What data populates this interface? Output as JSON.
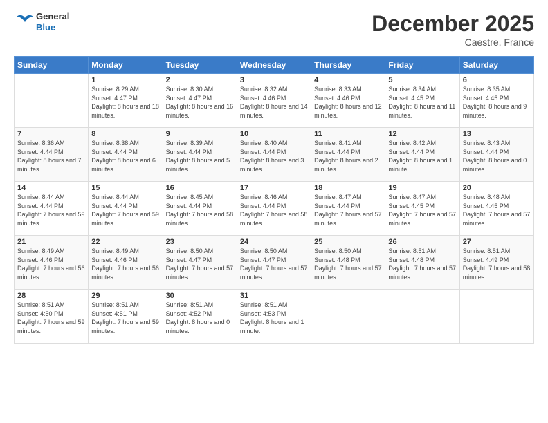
{
  "header": {
    "logo_general": "General",
    "logo_blue": "Blue",
    "month_title": "December 2025",
    "location": "Caestre, France"
  },
  "days_of_week": [
    "Sunday",
    "Monday",
    "Tuesday",
    "Wednesday",
    "Thursday",
    "Friday",
    "Saturday"
  ],
  "weeks": [
    [
      {
        "day": "",
        "sunrise": "",
        "sunset": "",
        "daylight": ""
      },
      {
        "day": "1",
        "sunrise": "Sunrise: 8:29 AM",
        "sunset": "Sunset: 4:47 PM",
        "daylight": "Daylight: 8 hours and 18 minutes."
      },
      {
        "day": "2",
        "sunrise": "Sunrise: 8:30 AM",
        "sunset": "Sunset: 4:47 PM",
        "daylight": "Daylight: 8 hours and 16 minutes."
      },
      {
        "day": "3",
        "sunrise": "Sunrise: 8:32 AM",
        "sunset": "Sunset: 4:46 PM",
        "daylight": "Daylight: 8 hours and 14 minutes."
      },
      {
        "day": "4",
        "sunrise": "Sunrise: 8:33 AM",
        "sunset": "Sunset: 4:46 PM",
        "daylight": "Daylight: 8 hours and 12 minutes."
      },
      {
        "day": "5",
        "sunrise": "Sunrise: 8:34 AM",
        "sunset": "Sunset: 4:45 PM",
        "daylight": "Daylight: 8 hours and 11 minutes."
      },
      {
        "day": "6",
        "sunrise": "Sunrise: 8:35 AM",
        "sunset": "Sunset: 4:45 PM",
        "daylight": "Daylight: 8 hours and 9 minutes."
      }
    ],
    [
      {
        "day": "7",
        "sunrise": "Sunrise: 8:36 AM",
        "sunset": "Sunset: 4:44 PM",
        "daylight": "Daylight: 8 hours and 7 minutes."
      },
      {
        "day": "8",
        "sunrise": "Sunrise: 8:38 AM",
        "sunset": "Sunset: 4:44 PM",
        "daylight": "Daylight: 8 hours and 6 minutes."
      },
      {
        "day": "9",
        "sunrise": "Sunrise: 8:39 AM",
        "sunset": "Sunset: 4:44 PM",
        "daylight": "Daylight: 8 hours and 5 minutes."
      },
      {
        "day": "10",
        "sunrise": "Sunrise: 8:40 AM",
        "sunset": "Sunset: 4:44 PM",
        "daylight": "Daylight: 8 hours and 3 minutes."
      },
      {
        "day": "11",
        "sunrise": "Sunrise: 8:41 AM",
        "sunset": "Sunset: 4:44 PM",
        "daylight": "Daylight: 8 hours and 2 minutes."
      },
      {
        "day": "12",
        "sunrise": "Sunrise: 8:42 AM",
        "sunset": "Sunset: 4:44 PM",
        "daylight": "Daylight: 8 hours and 1 minute."
      },
      {
        "day": "13",
        "sunrise": "Sunrise: 8:43 AM",
        "sunset": "Sunset: 4:44 PM",
        "daylight": "Daylight: 8 hours and 0 minutes."
      }
    ],
    [
      {
        "day": "14",
        "sunrise": "Sunrise: 8:44 AM",
        "sunset": "Sunset: 4:44 PM",
        "daylight": "Daylight: 7 hours and 59 minutes."
      },
      {
        "day": "15",
        "sunrise": "Sunrise: 8:44 AM",
        "sunset": "Sunset: 4:44 PM",
        "daylight": "Daylight: 7 hours and 59 minutes."
      },
      {
        "day": "16",
        "sunrise": "Sunrise: 8:45 AM",
        "sunset": "Sunset: 4:44 PM",
        "daylight": "Daylight: 7 hours and 58 minutes."
      },
      {
        "day": "17",
        "sunrise": "Sunrise: 8:46 AM",
        "sunset": "Sunset: 4:44 PM",
        "daylight": "Daylight: 7 hours and 58 minutes."
      },
      {
        "day": "18",
        "sunrise": "Sunrise: 8:47 AM",
        "sunset": "Sunset: 4:44 PM",
        "daylight": "Daylight: 7 hours and 57 minutes."
      },
      {
        "day": "19",
        "sunrise": "Sunrise: 8:47 AM",
        "sunset": "Sunset: 4:45 PM",
        "daylight": "Daylight: 7 hours and 57 minutes."
      },
      {
        "day": "20",
        "sunrise": "Sunrise: 8:48 AM",
        "sunset": "Sunset: 4:45 PM",
        "daylight": "Daylight: 7 hours and 57 minutes."
      }
    ],
    [
      {
        "day": "21",
        "sunrise": "Sunrise: 8:49 AM",
        "sunset": "Sunset: 4:46 PM",
        "daylight": "Daylight: 7 hours and 56 minutes."
      },
      {
        "day": "22",
        "sunrise": "Sunrise: 8:49 AM",
        "sunset": "Sunset: 4:46 PM",
        "daylight": "Daylight: 7 hours and 56 minutes."
      },
      {
        "day": "23",
        "sunrise": "Sunrise: 8:50 AM",
        "sunset": "Sunset: 4:47 PM",
        "daylight": "Daylight: 7 hours and 57 minutes."
      },
      {
        "day": "24",
        "sunrise": "Sunrise: 8:50 AM",
        "sunset": "Sunset: 4:47 PM",
        "daylight": "Daylight: 7 hours and 57 minutes."
      },
      {
        "day": "25",
        "sunrise": "Sunrise: 8:50 AM",
        "sunset": "Sunset: 4:48 PM",
        "daylight": "Daylight: 7 hours and 57 minutes."
      },
      {
        "day": "26",
        "sunrise": "Sunrise: 8:51 AM",
        "sunset": "Sunset: 4:48 PM",
        "daylight": "Daylight: 7 hours and 57 minutes."
      },
      {
        "day": "27",
        "sunrise": "Sunrise: 8:51 AM",
        "sunset": "Sunset: 4:49 PM",
        "daylight": "Daylight: 7 hours and 58 minutes."
      }
    ],
    [
      {
        "day": "28",
        "sunrise": "Sunrise: 8:51 AM",
        "sunset": "Sunset: 4:50 PM",
        "daylight": "Daylight: 7 hours and 59 minutes."
      },
      {
        "day": "29",
        "sunrise": "Sunrise: 8:51 AM",
        "sunset": "Sunset: 4:51 PM",
        "daylight": "Daylight: 7 hours and 59 minutes."
      },
      {
        "day": "30",
        "sunrise": "Sunrise: 8:51 AM",
        "sunset": "Sunset: 4:52 PM",
        "daylight": "Daylight: 8 hours and 0 minutes."
      },
      {
        "day": "31",
        "sunrise": "Sunrise: 8:51 AM",
        "sunset": "Sunset: 4:53 PM",
        "daylight": "Daylight: 8 hours and 1 minute."
      },
      {
        "day": "",
        "sunrise": "",
        "sunset": "",
        "daylight": ""
      },
      {
        "day": "",
        "sunrise": "",
        "sunset": "",
        "daylight": ""
      },
      {
        "day": "",
        "sunrise": "",
        "sunset": "",
        "daylight": ""
      }
    ]
  ]
}
